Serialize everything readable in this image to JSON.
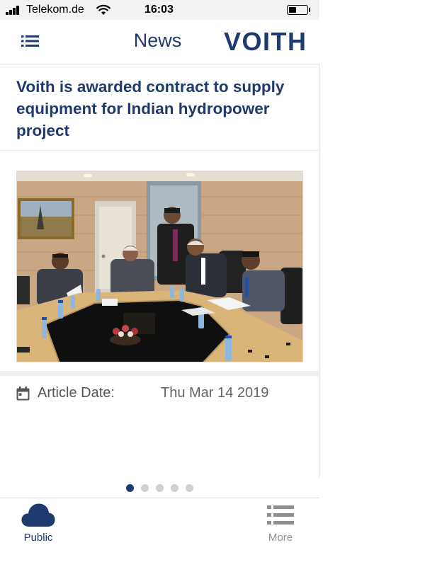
{
  "status_bar": {
    "carrier": "Telekom.de",
    "time": "16:03",
    "battery_level": 0.45
  },
  "nav": {
    "title": "News",
    "logo_text": "VOITH",
    "menu_icon": "list-icon"
  },
  "article": {
    "headline": "Voith is awarded contract to supply equipment for Indian hydropower project",
    "image_icon": "meeting-photo",
    "date_icon": "calendar-icon",
    "date_label": "Article Date:",
    "date_value": "Thu Mar 14 2019"
  },
  "pagination": {
    "total": 5,
    "active_index": 0
  },
  "tabs": [
    {
      "label": "Public",
      "icon": "cloud-icon",
      "active": true
    },
    {
      "label": "More",
      "icon": "list-icon",
      "active": false
    }
  ],
  "colors": {
    "brand": "#1e3a6e",
    "inactive": "#8e8e8e",
    "dot_inactive": "#d0d0d0"
  }
}
